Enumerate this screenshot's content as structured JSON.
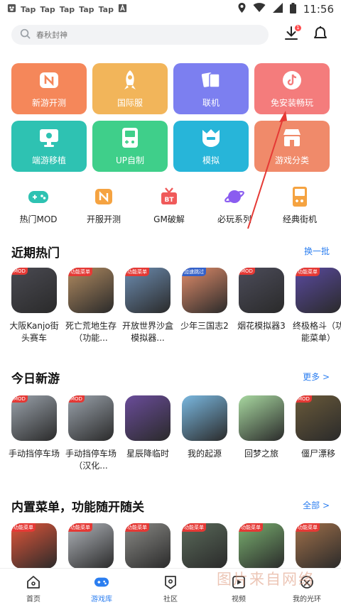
{
  "status_bar": {
    "left_labels": [
      "Tap",
      "Tap",
      "Tap",
      "Tap",
      "Tap"
    ],
    "time": "11:56"
  },
  "header": {
    "search_placeholder": "春秋封神",
    "download_badge": "1"
  },
  "categories": [
    {
      "label": "新游开测",
      "color": "#f5875a",
      "icon": "new-game-icon"
    },
    {
      "label": "国际服",
      "color": "#f2b55a",
      "icon": "rocket-icon"
    },
    {
      "label": "联机",
      "color": "#7c7ff0",
      "icon": "cards-icon"
    },
    {
      "label": "免安装畅玩",
      "color": "#f47c7c",
      "icon": "tiktok-icon"
    },
    {
      "label": "端游移植",
      "color": "#2ec2b2",
      "icon": "monitor-icon"
    },
    {
      "label": "UP自制",
      "color": "#3fcf8a",
      "icon": "handheld-icon"
    },
    {
      "label": "模拟",
      "color": "#27b5d9",
      "icon": "helmet-icon"
    },
    {
      "label": "游戏分类",
      "color": "#f08a6a",
      "icon": "store-icon"
    }
  ],
  "small_categories": [
    {
      "label": "热门MOD",
      "color": "#2ec2b2",
      "icon": "gamepad-icon"
    },
    {
      "label": "开服开测",
      "color": "#f5a341",
      "icon": "server-icon"
    },
    {
      "label": "GM破解",
      "color": "#f05a5a",
      "icon": "gift-icon"
    },
    {
      "label": "必玩系列",
      "color": "#8a5cf0",
      "icon": "planet-icon"
    },
    {
      "label": "经典街机",
      "color": "#f5a341",
      "icon": "arcade-icon"
    }
  ],
  "sections": [
    {
      "title": "近期热门",
      "more": "换一批",
      "games": [
        {
          "name": "大阪Kanjo街头赛车",
          "tag": "MOD",
          "tag_style": "red",
          "color": "#4a4a52"
        },
        {
          "name": "死亡荒地生存（功能...",
          "tag": "功能菜单",
          "tag_style": "red",
          "color": "#b08a60"
        },
        {
          "name": "开放世界沙盒模拟器...",
          "tag": "功能菜单",
          "tag_style": "red",
          "color": "#6c8cb0"
        },
        {
          "name": "少年三国志2",
          "tag": "加速跳过",
          "tag_style": "blue",
          "color": "#e08c6a"
        },
        {
          "name": "烟花模拟器3",
          "tag": "MOD",
          "tag_style": "red",
          "color": "#4c4c5a"
        },
        {
          "name": "终极格斗（功能菜单）",
          "tag": "功能菜单",
          "tag_style": "red",
          "color": "#5a4aa0"
        }
      ]
    },
    {
      "title": "今日新游",
      "more": "更多 >",
      "games": [
        {
          "name": "手动挡停车场",
          "tag": "MOD",
          "tag_style": "red",
          "color": "#9aa2ab"
        },
        {
          "name": "手动挡停车场（汉化...",
          "tag": "MOD",
          "tag_style": "red",
          "color": "#9aa2ab"
        },
        {
          "name": "星辰降临时",
          "tag": "",
          "tag_style": "",
          "color": "#6a4c9a"
        },
        {
          "name": "我的起源",
          "tag": "",
          "tag_style": "",
          "color": "#7ab8e0"
        },
        {
          "name": "回梦之旅",
          "tag": "",
          "tag_style": "",
          "color": "#a8d8a0"
        },
        {
          "name": "僵尸漂移",
          "tag": "MOD",
          "tag_style": "red",
          "color": "#6a5a3a"
        }
      ]
    },
    {
      "title": "内置菜单，功能随开随关",
      "more": "全部 >",
      "games": [
        {
          "name": "",
          "tag": "功能菜单",
          "tag_style": "red",
          "color": "#e0563a"
        },
        {
          "name": "",
          "tag": "功能菜单",
          "tag_style": "red",
          "color": "#b0b4ba"
        },
        {
          "name": "",
          "tag": "功能菜单",
          "tag_style": "red",
          "color": "#8a8a86"
        },
        {
          "name": "",
          "tag": "功能菜单",
          "tag_style": "red",
          "color": "#5a6a5a"
        },
        {
          "name": "",
          "tag": "功能菜单",
          "tag_style": "red",
          "color": "#7ab070"
        },
        {
          "name": "",
          "tag": "功能菜单",
          "tag_style": "red",
          "color": "#a0704a"
        }
      ]
    }
  ],
  "bottom_nav": [
    {
      "label": "首页",
      "icon": "home-icon"
    },
    {
      "label": "游戏库",
      "icon": "game-library-icon"
    },
    {
      "label": "社区",
      "icon": "community-icon"
    },
    {
      "label": "视频",
      "icon": "video-icon"
    },
    {
      "label": "我的光环",
      "icon": "profile-icon"
    }
  ],
  "watermark": "图片来自网络",
  "colors": {
    "accent": "#2b7ef0",
    "arrow": "#e53935"
  }
}
